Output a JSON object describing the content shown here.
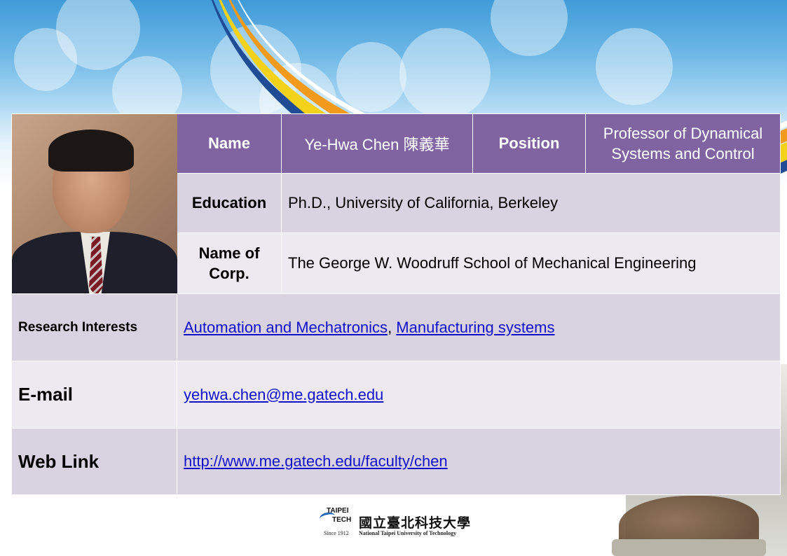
{
  "header": {
    "name_label": "Name",
    "name_value": "Ye-Hwa Chen 陳義華",
    "position_label": "Position",
    "position_value": "Professor of Dynamical Systems and Control"
  },
  "education": {
    "label": "Education",
    "value": "Ph.D., University of California, Berkeley"
  },
  "corp": {
    "label": "Name of Corp.",
    "value": "The George W. Woodruff School of Mechanical Engineering"
  },
  "research": {
    "label": "Research Interests",
    "links": [
      "Automation and Mechatronics",
      "Manufacturing systems"
    ],
    "separator": ", "
  },
  "email": {
    "label": "E-mail",
    "value": "yehwa.chen@me.gatech.edu"
  },
  "web": {
    "label": "Web Link",
    "value": "http://www.me.gatech.edu/faculty/chen"
  },
  "logo": {
    "taipei": "TAIPEI",
    "tech": "TECH",
    "since": "Since 1912",
    "chinese_name": "國立臺北科技大學",
    "english_name": "National Taipei University of Technology"
  },
  "colors": {
    "header_purple": "#8064a2",
    "row_dark": "#d9d2e0",
    "row_light": "#ede9f0",
    "link": "#1111cc"
  }
}
